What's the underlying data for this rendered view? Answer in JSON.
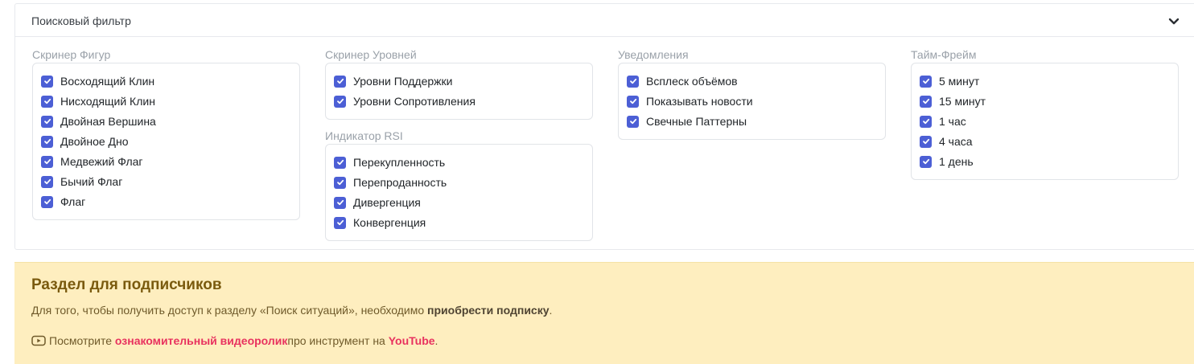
{
  "filter": {
    "title": "Поисковый фильтр",
    "groups": [
      {
        "label": "Скринер Фигур",
        "options": [
          {
            "label": "Восходящий Клин",
            "checked": true
          },
          {
            "label": "Нисходящий Клин",
            "checked": true
          },
          {
            "label": "Двойная Вершина",
            "checked": true
          },
          {
            "label": "Двойное Дно",
            "checked": true
          },
          {
            "label": "Медвежий Флаг",
            "checked": true
          },
          {
            "label": "Бычий Флаг",
            "checked": true
          },
          {
            "label": "Флаг",
            "checked": true
          }
        ]
      },
      {
        "label": "Скринер Уровней",
        "options": [
          {
            "label": "Уровни Поддержки",
            "checked": true
          },
          {
            "label": "Уровни Сопротивления",
            "checked": true
          }
        ]
      },
      {
        "label": "Индикатор RSI",
        "options": [
          {
            "label": "Перекупленность",
            "checked": true
          },
          {
            "label": "Перепроданность",
            "checked": true
          },
          {
            "label": "Дивергенция",
            "checked": true
          },
          {
            "label": "Конвергенция",
            "checked": true
          }
        ]
      },
      {
        "label": "Уведомления",
        "options": [
          {
            "label": "Всплеск объёмов",
            "checked": true
          },
          {
            "label": "Показывать новости",
            "checked": true
          },
          {
            "label": "Свечные Паттерны",
            "checked": true
          }
        ]
      },
      {
        "label": "Тайм-Фрейм",
        "options": [
          {
            "label": "5 минут",
            "checked": true
          },
          {
            "label": "15 минут",
            "checked": true
          },
          {
            "label": "1 час",
            "checked": true
          },
          {
            "label": "4 часа",
            "checked": true
          },
          {
            "label": "1 день",
            "checked": true
          }
        ]
      }
    ]
  },
  "subscription": {
    "title": "Раздел для подписчиков",
    "text_before": "Для того, чтобы получить доступ к разделу «Поиск ситуаций», необходимо ",
    "text_bold": "приобрести подписку",
    "text_after": ".",
    "video_prefix": "Посмотрите ",
    "video_link": "ознакомительный видеоролик",
    "video_middle": " про инструмент на ",
    "youtube_link": "YouTube",
    "video_suffix": "."
  },
  "colors": {
    "accent": "#4c5fd5",
    "banner_bg": "#feeebf",
    "link": "#e8325f"
  }
}
